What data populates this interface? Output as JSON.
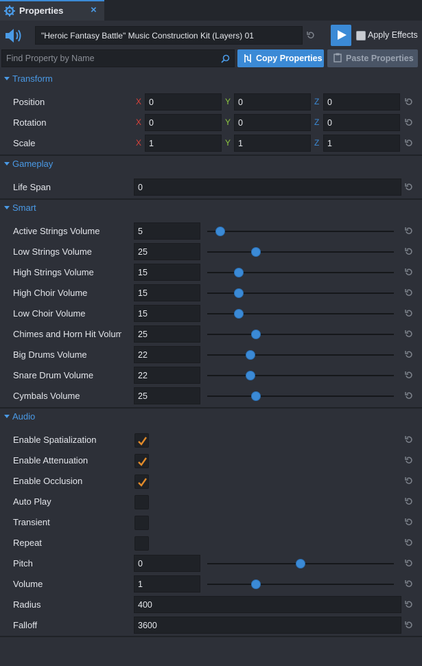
{
  "tab": {
    "label": "Properties",
    "close": "×",
    "icon": "wrench-gear-icon"
  },
  "header": {
    "object_name": "\"Heroic Fantasy Battle\" Music Construction Kit (Layers) 01",
    "apply_effects_label": "Apply Effects",
    "apply_effects_checked": false
  },
  "search": {
    "placeholder": "Find Property by Name"
  },
  "toolbar": {
    "copy_label": "Copy Properties",
    "paste_label": "Paste Properties"
  },
  "axes": {
    "x": "X",
    "y": "Y",
    "z": "Z"
  },
  "colors": {
    "accent": "#3b8ad6",
    "axis_x": "#d9423a",
    "axis_y": "#8dc63f",
    "axis_z": "#3b8ad6",
    "check": "#e08a2a"
  },
  "sections": {
    "transform": {
      "title": "Transform",
      "rows": [
        {
          "label": "Position",
          "x": "0",
          "y": "0",
          "z": "0"
        },
        {
          "label": "Rotation",
          "x": "0",
          "y": "0",
          "z": "0"
        },
        {
          "label": "Scale",
          "x": "1",
          "y": "1",
          "z": "1"
        }
      ]
    },
    "gameplay": {
      "title": "Gameplay",
      "rows": [
        {
          "label": "Life Span",
          "value": "0"
        }
      ]
    },
    "smart": {
      "title": "Smart",
      "rows": [
        {
          "label": "Active Strings Volume",
          "value": "5",
          "slider": 0.07
        },
        {
          "label": "Low Strings Volume",
          "value": "25",
          "slider": 0.26
        },
        {
          "label": "High Strings Volume",
          "value": "15",
          "slider": 0.17
        },
        {
          "label": "High Choir Volume",
          "value": "15",
          "slider": 0.17
        },
        {
          "label": "Low Choir Volume",
          "value": "15",
          "slider": 0.17
        },
        {
          "label": "Chimes and Horn Hit Volum",
          "value": "25",
          "slider": 0.26
        },
        {
          "label": "Big Drums Volume",
          "value": "22",
          "slider": 0.23
        },
        {
          "label": "Snare Drum Volume",
          "value": "22",
          "slider": 0.23
        },
        {
          "label": "Cymbals Volume",
          "value": "25",
          "slider": 0.26
        }
      ]
    },
    "audio": {
      "title": "Audio",
      "checks": [
        {
          "label": "Enable Spatialization",
          "checked": true
        },
        {
          "label": "Enable Attenuation",
          "checked": true
        },
        {
          "label": "Enable Occlusion",
          "checked": true
        },
        {
          "label": "Auto Play",
          "checked": false
        },
        {
          "label": "Transient",
          "checked": false
        },
        {
          "label": "Repeat",
          "checked": false
        }
      ],
      "pitch": {
        "label": "Pitch",
        "value": "0",
        "slider": 0.5
      },
      "volume": {
        "label": "Volume",
        "value": "1",
        "slider": 0.26
      },
      "radius": {
        "label": "Radius",
        "value": "400"
      },
      "falloff": {
        "label": "Falloff",
        "value": "3600"
      }
    }
  }
}
